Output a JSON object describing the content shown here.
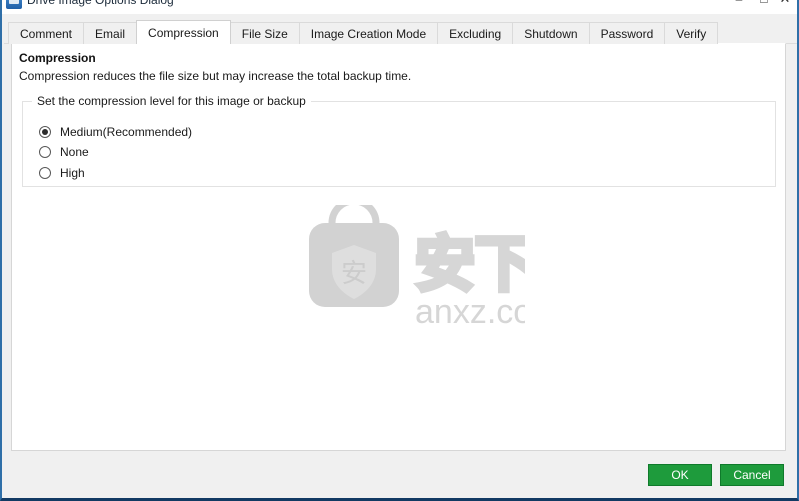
{
  "window": {
    "title": "Drive Image Options Dialog",
    "icon": "app-icon",
    "controls": {
      "minimize": "–",
      "maximize": "□",
      "close": "✕"
    },
    "border_color": "#2f6fa8"
  },
  "tabs": [
    {
      "label": "Comment",
      "active": false
    },
    {
      "label": "Email",
      "active": false
    },
    {
      "label": "Compression",
      "active": true
    },
    {
      "label": "File Size",
      "active": false
    },
    {
      "label": "Image Creation Mode",
      "active": false
    },
    {
      "label": "Excluding",
      "active": false
    },
    {
      "label": "Shutdown",
      "active": false
    },
    {
      "label": "Password",
      "active": false
    },
    {
      "label": "Verify",
      "active": false
    }
  ],
  "page": {
    "heading": "Compression",
    "description": "Compression reduces the file size but may increase the total backup time."
  },
  "group": {
    "legend": "Set the compression level for this image or backup",
    "options": [
      {
        "label": "Medium(Recommended)",
        "selected": true
      },
      {
        "label": "None",
        "selected": false
      },
      {
        "label": "High",
        "selected": false
      }
    ]
  },
  "watermark": {
    "site": "anxz.com",
    "characters": "安下载",
    "badge_character": "安",
    "color": "#d4d4d4"
  },
  "footer": {
    "ok_label": "OK",
    "cancel_label": "Cancel",
    "button_color": "#1e9b3c"
  }
}
